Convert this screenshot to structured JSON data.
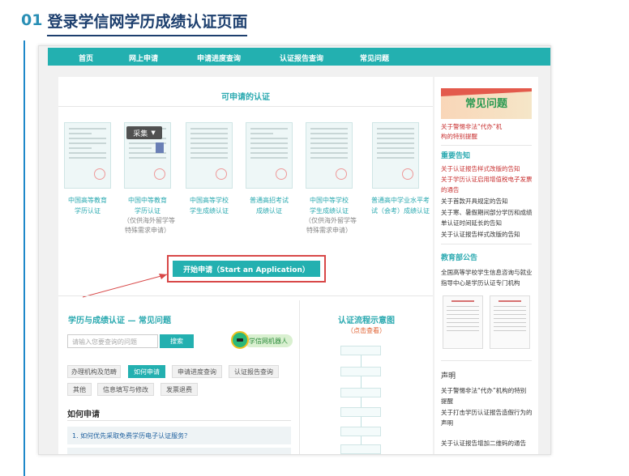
{
  "heading": {
    "number": "01",
    "title": "登录学信网学历成绩认证页面"
  },
  "nav": {
    "items": [
      "首页",
      "网上申请",
      "申请进度查询",
      "认证报告查询",
      "常见问题"
    ]
  },
  "main": {
    "section_title": "可申请的认证",
    "collect_label": "采集",
    "certs": [
      {
        "label1": "中国高等教育",
        "label2": "学历认证",
        "sub": []
      },
      {
        "label1": "中国中等教育",
        "label2": "学历认证",
        "sub": [
          "（仅供海外留学等",
          "特殊需求申请）"
        ]
      },
      {
        "label1": "中国高等学校",
        "label2": "学生成绩认证",
        "sub": []
      },
      {
        "label1": "普通高招考试",
        "label2": "成绩认证",
        "sub": []
      },
      {
        "label1": "中国中等学校",
        "label2": "学生成绩认证",
        "sub": [
          "（仅供海外留学等",
          "特殊需求申请）"
        ]
      },
      {
        "label1": "普通高中学业水平考",
        "label2": "试（会考）成绩认证",
        "sub": []
      }
    ],
    "start_button": "开始申请（Start an Application）",
    "faq_title": "学历与成绩认证 — 常见问题",
    "search_placeholder": "请输入您要查询的问题",
    "search_button": "搜索",
    "robot_label": "学信网机器人",
    "tags": [
      "办理机构及范畴",
      "如何申请",
      "申请进度查询",
      "认证报告查询",
      "其他",
      "信息填写与修改",
      "发票退费"
    ],
    "howto_title": "如何申请",
    "question1": "1. 如何优先采取免费学历电子认证服务？",
    "flow_title": "认证流程示意图",
    "flow_sub": "（点击查看）"
  },
  "side": {
    "banner": "常见问题",
    "faq_links": [
      "关于警惕非法“代办”机",
      "构的特别提醒"
    ],
    "notice_title": "重要告知",
    "notice_links": [
      "关于认证报告样式改版的告知",
      "关于学历认证启用增值税电子发票",
      "的通告",
      "关于首款开具规定的告知",
      "关于寒、暑假期间部分学历和成绩",
      "单认证时间延长的告知",
      "关于认证报告样式改版的告知"
    ],
    "edu_title": "教育部公告",
    "edu_text": [
      "全国高等学校学生信息咨询与就业",
      "指导中心是学历认证专门机构"
    ],
    "statement_title": "声明",
    "statement_links": [
      "关于警惕非法“代办”机构的特别",
      "提醒",
      "关于打击学历认证报告造假行为的",
      "声明"
    ],
    "last_link": "关于认证报告增加二维码的通告"
  }
}
